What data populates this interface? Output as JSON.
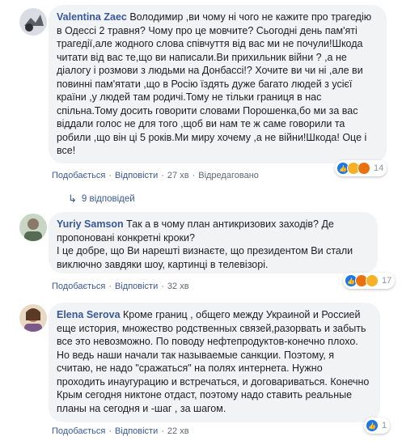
{
  "comments": [
    {
      "author": "Valentina Zaec",
      "text": "Володимир ,ви чому ні чого не кажите про трагедію в Одессі 2 травня? Чому про це мовчите? Сьогодні день пам'яті трагедії,але жодного слова співчуття від вас ми не почули!Шкода читати від вас те,що ви написали.Ви прихильник війни ? ,а не діалогу і розмови з людьми на Донбассі!? Хочите ви чи ні ,але ви повинні пам'ятати ,що в Росію їздять дуже багато людей з усієї країни ,у людей там родичі.Тому не тільки границя в нас спільна.Тому досить говорити словами Порошенка,бо ми за вас віддали голос не для того ,щоб ви нам те ж саме говорили та робили ,що він ці 5 років.Ми миру хочему ,а не війни!Шкода! Оце і все!",
      "like": "Подобається",
      "reply": "Відповісти",
      "time": "27 хв",
      "edited": "Відредаговано",
      "reaction_count": "14"
    },
    {
      "author": "Yuriy Samson",
      "text": "Так а в чому план антикризових заходів? Де пропоновані конкретні кроки?\nІ це добре, що Ви нарешті визнаєте, що президентом Ви стали виключно завдяки шоу, картинці в телевізорі.",
      "like": "Подобається",
      "reply": "Відповісти",
      "time": "32 хв",
      "reaction_count": "17"
    },
    {
      "author": "Elena Serova",
      "text": "Кроме границ , общего между Украиной и Россией еще история, множество родственных связей,разорвать и забыть все это невозможно. По поводу нефтепродуктов-конечно плохо. Но ведь наши начали так называемые санкции. Поэтому, я считаю, не надо \"сражаться\" на полях интернета. Нужно проходить инаугурацию и встречаться, и договариваться. Конечно Крым сегодня никтоне отдаст, поэтому надо ставить реальные планы на сегодня и -шаг , за шагом.",
      "like": "Подобається",
      "reply": "Відповісти",
      "time": "22 хв",
      "reaction_count": "1"
    }
  ],
  "replies_link": "9 відповідей",
  "colors": {
    "link": "#385898",
    "bubble": "#f2f3f5",
    "like_blue": "#1877f2",
    "haha_yellow": "#f7b125",
    "angry_red": "#e9710f"
  }
}
